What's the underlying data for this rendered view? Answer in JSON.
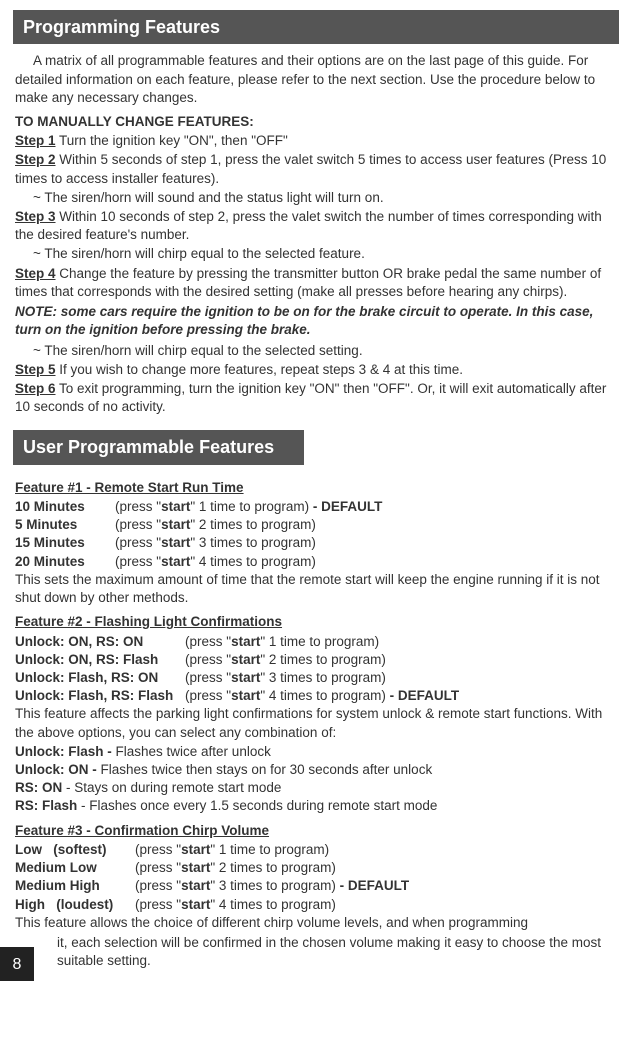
{
  "page_number": "8",
  "section1": {
    "title": "Programming Features",
    "intro": "A matrix of all programmable features and their options are on the last page of this guide. For detailed information on each feature, please refer to the next section. Use the procedure below to make any necessary changes.",
    "manual_heading": "TO MANUALLY CHANGE FEATURES:",
    "steps": {
      "s1_label": "Step 1",
      "s1_text": "  Turn the ignition key \"ON\", then \"OFF\"",
      "s2_label": "Step 2",
      "s2_text": "  Within 5 seconds of step 1, press the valet switch 5 times to access user features (Press 10 times to access installer features).",
      "s2_result": "~ The siren/horn will sound and the status light will turn on.",
      "s3_label": "Step 3",
      "s3_text": "  Within 10 seconds of step 2, press the valet switch the number of times corresponding with the desired feature's number.",
      "s3_result": "~ The siren/horn will chirp equal to the selected feature.",
      "s4_label": "Step 4",
      "s4_text": "   Change the feature by pressing the transmitter button OR brake pedal the same number of times that corresponds with the desired setting (make all presses before hearing any chirps).",
      "s4_note": "NOTE: some cars require the ignition to be on for the brake circuit to operate. In this case, turn on the ignition before pressing the brake.",
      "s4_result": "~ The siren/horn will chirp equal to the selected setting.",
      "s5_label": "Step 5",
      "s5_text": "  If you wish to change more features, repeat steps 3 & 4 at this time.",
      "s6_label": "Step 6",
      "s6_text": "  To exit programming, turn the ignition key \"ON\" then \"OFF\". Or, it will exit automatically after 10 seconds of no activity."
    }
  },
  "section2": {
    "title": "User Programmable Features",
    "feature1": {
      "title": "Feature #1 - Remote Start Run Time",
      "options": [
        {
          "label": "10 Minutes",
          "action_pre": "(press \"",
          "action_bold": "start",
          "action_post": "\" 1 time to program)",
          "suffix": " - DEFAULT"
        },
        {
          "label": "5 Minutes",
          "action_pre": "(press \"",
          "action_bold": "start",
          "action_post": "\" 2 times to program)",
          "suffix": ""
        },
        {
          "label": "15 Minutes",
          "action_pre": "(press \"",
          "action_bold": "start",
          "action_post": "\" 3 times to program)",
          "suffix": ""
        },
        {
          "label": "20 Minutes",
          "action_pre": "(press \"",
          "action_bold": "start",
          "action_post": "\" 4 times to program)",
          "suffix": ""
        }
      ],
      "desc": "This sets the maximum amount of time that the remote start will keep the engine running if it is not shut down by other methods."
    },
    "feature2": {
      "title": "Feature #2 - Flashing Light Confirmations",
      "options": [
        {
          "label": "Unlock: ON, RS: ON",
          "action_pre": "(press \"",
          "action_bold": "start",
          "action_post": "\" 1 time to program)",
          "suffix": ""
        },
        {
          "label": "Unlock: ON, RS: Flash",
          "action_pre": "(press \"",
          "action_bold": "start",
          "action_post": "\" 2 times to program)",
          "suffix": ""
        },
        {
          "label": "Unlock: Flash, RS: ON",
          "action_pre": "(press \"",
          "action_bold": "start",
          "action_post": "\" 3 times to program)",
          "suffix": ""
        },
        {
          "label": "Unlock: Flash, RS: Flash",
          "action_pre": "(press \"",
          "action_bold": "start",
          "action_post": "\" 4 times to program)",
          "suffix": " - DEFAULT"
        }
      ],
      "desc1": "This feature affects the parking light confirmations for system unlock & remote start functions.  With the above options, you can select any combination of:",
      "sub": [
        {
          "b": "Unlock: Flash - ",
          "t": "Flashes twice after unlock"
        },
        {
          "b": "Unlock: ON - ",
          "t": "Flashes twice then stays on for 30 seconds after unlock"
        },
        {
          "b": "RS: ON",
          "t": " - Stays on during remote start mode"
        },
        {
          "b": "RS: Flash",
          "t": " - Flashes once every 1.5 seconds during remote start mode"
        }
      ]
    },
    "feature3": {
      "title": "Feature #3 - Confirmation Chirp Volume ",
      "options": [
        {
          "label": "Low   (softest)",
          "action_pre": "(press \"",
          "action_bold": "start",
          "action_post": "\" 1 time to program)",
          "suffix": ""
        },
        {
          "label": "Medium Low",
          "action_pre": "(press \"",
          "action_bold": "start",
          "action_post": "\" 2 times to program)",
          "suffix": ""
        },
        {
          "label": "Medium High",
          "action_pre": "(press \"",
          "action_bold": "start",
          "action_post": "\" 3 times to program)",
          "suffix": " - DEFAULT"
        },
        {
          "label": "High   (loudest)",
          "action_pre": "(press \"",
          "action_bold": "start",
          "action_post": "\" 4 times to program)",
          "suffix": ""
        }
      ],
      "desc_line1": "This feature allows the choice of different chirp volume levels, and when programming",
      "desc_line2": "it, each selection will be confirmed in the chosen volume making it easy to choose the most suitable setting."
    }
  }
}
